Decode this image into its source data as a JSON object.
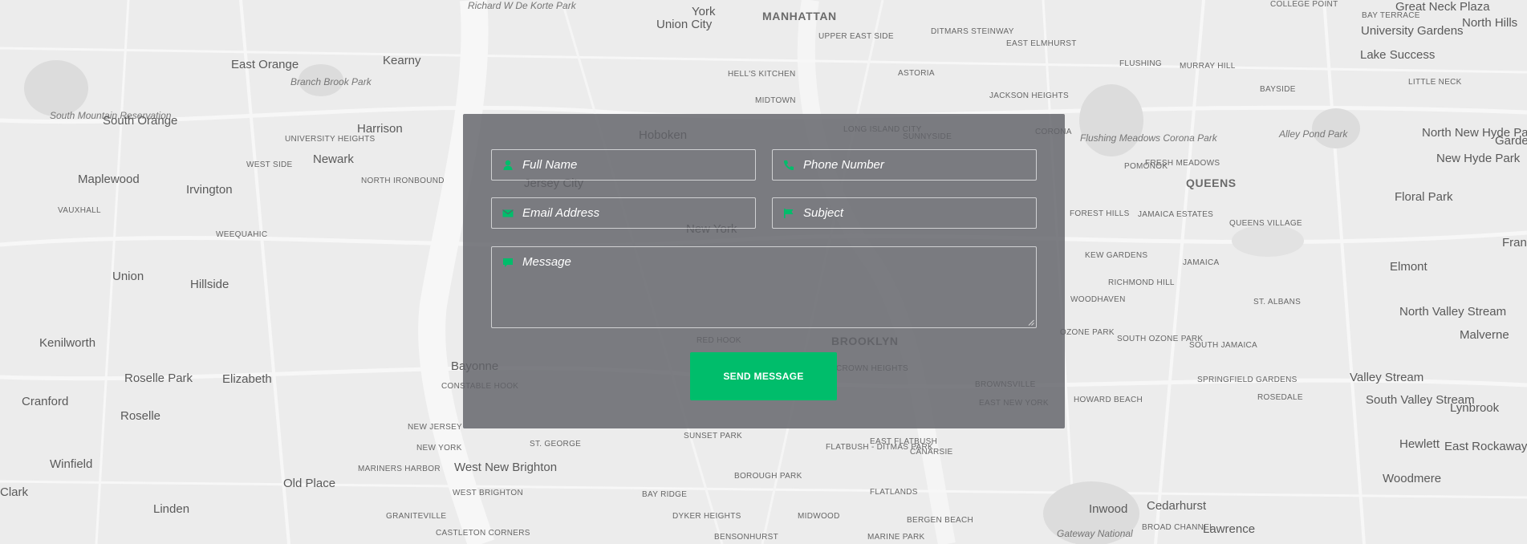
{
  "map": {
    "labels": [
      {
        "text": "Richard W De Korte Park",
        "cls": "italic"
      },
      {
        "text": "Union City",
        "cls": "major"
      },
      {
        "text": "York",
        "cls": "major"
      },
      {
        "text": "MANHATTAN",
        "cls": "bold"
      },
      {
        "text": "COLLEGE POINT",
        "cls": "caps"
      },
      {
        "text": "BAY TERRACE",
        "cls": "caps"
      },
      {
        "text": "Great Neck Plaza",
        "cls": "major"
      },
      {
        "text": "North Hills",
        "cls": "major"
      },
      {
        "text": "East Orange",
        "cls": "major"
      },
      {
        "text": "Kearny",
        "cls": "major"
      },
      {
        "text": "Branch Brook Park",
        "cls": "italic"
      },
      {
        "text": "UPPER EAST SIDE",
        "cls": "caps"
      },
      {
        "text": "DITMARS STEINWAY",
        "cls": "caps"
      },
      {
        "text": "EAST ELMHURST",
        "cls": "caps"
      },
      {
        "text": "University Gardens",
        "cls": "major"
      },
      {
        "text": "Lake Success",
        "cls": "major"
      },
      {
        "text": "HELL'S KITCHEN",
        "cls": "caps"
      },
      {
        "text": "ASTORIA",
        "cls": "caps"
      },
      {
        "text": "FLUSHING",
        "cls": "caps"
      },
      {
        "text": "MURRAY HILL",
        "cls": "caps"
      },
      {
        "text": "LITTLE NECK",
        "cls": "caps"
      },
      {
        "text": "South Mountain Reservation",
        "cls": "italic"
      },
      {
        "text": "South Orange",
        "cls": "major"
      },
      {
        "text": "Harrison",
        "cls": "major"
      },
      {
        "text": "MIDTOWN",
        "cls": "caps"
      },
      {
        "text": "JACKSON HEIGHTS",
        "cls": "caps"
      },
      {
        "text": "BAYSIDE",
        "cls": "caps"
      },
      {
        "text": "Hoboken",
        "cls": "major"
      },
      {
        "text": "LONG ISLAND CITY",
        "cls": "caps"
      },
      {
        "text": "SUNNYSIDE",
        "cls": "caps"
      },
      {
        "text": "CORONA",
        "cls": "caps"
      },
      {
        "text": "Flushing Meadows Corona Park",
        "cls": "italic"
      },
      {
        "text": "Alley Pond Park",
        "cls": "italic"
      },
      {
        "text": "North New Hyde Park",
        "cls": "major"
      },
      {
        "text": "New Hyde Park",
        "cls": "major"
      },
      {
        "text": "Garden City",
        "cls": "major"
      },
      {
        "text": "Newark",
        "cls": "major"
      },
      {
        "text": "UNIVERSITY HEIGHTS",
        "cls": "caps"
      },
      {
        "text": "Maplewood",
        "cls": "major"
      },
      {
        "text": "WEST SIDE",
        "cls": "caps"
      },
      {
        "text": "Irvington",
        "cls": "major"
      },
      {
        "text": "NORTH IRONBOUND",
        "cls": "caps"
      },
      {
        "text": "POMONOK",
        "cls": "caps"
      },
      {
        "text": "FRESH MEADOWS",
        "cls": "caps"
      },
      {
        "text": "QUEENS",
        "cls": "bold"
      },
      {
        "text": "Floral Park",
        "cls": "major"
      },
      {
        "text": "VAUXHALL",
        "cls": "caps"
      },
      {
        "text": "FOREST HILLS",
        "cls": "caps"
      },
      {
        "text": "JAMAICA ESTATES",
        "cls": "caps"
      },
      {
        "text": "QUEENS VILLAGE",
        "cls": "caps"
      },
      {
        "text": "WEEQUAHIC",
        "cls": "caps"
      },
      {
        "text": "Franklin Square",
        "cls": "major"
      },
      {
        "text": "Union",
        "cls": "major"
      },
      {
        "text": "Hillside",
        "cls": "major"
      },
      {
        "text": "KEW GARDENS",
        "cls": "caps"
      },
      {
        "text": "JAMAICA",
        "cls": "caps"
      },
      {
        "text": "Elmont",
        "cls": "major"
      },
      {
        "text": "RICHMOND HILL",
        "cls": "caps"
      },
      {
        "text": "WOODHAVEN",
        "cls": "caps"
      },
      {
        "text": "ST. ALBANS",
        "cls": "caps"
      },
      {
        "text": "North Valley Stream",
        "cls": "major"
      },
      {
        "text": "Kenilworth",
        "cls": "major"
      },
      {
        "text": "OZONE PARK",
        "cls": "caps"
      },
      {
        "text": "SOUTH OZONE PARK",
        "cls": "caps"
      },
      {
        "text": "SOUTH JAMAICA",
        "cls": "caps"
      },
      {
        "text": "Malverne",
        "cls": "major"
      },
      {
        "text": "Roselle Park",
        "cls": "major"
      },
      {
        "text": "Elizabeth",
        "cls": "major"
      },
      {
        "text": "Bayonne",
        "cls": "major"
      },
      {
        "text": "CONSTABLE HOOK",
        "cls": "caps"
      },
      {
        "text": "SPRINGFIELD GARDENS",
        "cls": "caps"
      },
      {
        "text": "Valley Stream",
        "cls": "major"
      },
      {
        "text": "Cranford",
        "cls": "major"
      },
      {
        "text": "HOWARD BEACH",
        "cls": "caps"
      },
      {
        "text": "ROSEDALE",
        "cls": "caps"
      },
      {
        "text": "South Valley Stream",
        "cls": "major"
      },
      {
        "text": "Lynbrook",
        "cls": "major"
      },
      {
        "text": "Roselle",
        "cls": "major"
      },
      {
        "text": "NEW JERSEY",
        "cls": "caps"
      },
      {
        "text": "NEW YORK",
        "cls": "caps"
      },
      {
        "text": "SUNSET PARK",
        "cls": "caps"
      },
      {
        "text": "EAST FLATBUSH",
        "cls": "caps"
      },
      {
        "text": "ST. GEORGE",
        "cls": "caps"
      },
      {
        "text": "FLATBUSH - DITMAS PARK",
        "cls": "caps"
      },
      {
        "text": "CANARSIE",
        "cls": "caps"
      },
      {
        "text": "Hewlett",
        "cls": "major"
      },
      {
        "text": "East Rockaway",
        "cls": "major"
      },
      {
        "text": "Winfield",
        "cls": "major"
      },
      {
        "text": "West New Brighton",
        "cls": "major"
      },
      {
        "text": "MARINERS HARBOR",
        "cls": "caps"
      },
      {
        "text": "BOROUGH PARK",
        "cls": "caps"
      },
      {
        "text": "Woodmere",
        "cls": "major"
      },
      {
        "text": "Clark",
        "cls": "major"
      },
      {
        "text": "Old Place",
        "cls": "major"
      },
      {
        "text": "WEST BRIGHTON",
        "cls": "caps"
      },
      {
        "text": "BAY RIDGE",
        "cls": "caps"
      },
      {
        "text": "FLATLANDS",
        "cls": "caps"
      },
      {
        "text": "Inwood",
        "cls": "major"
      },
      {
        "text": "Cedarhurst",
        "cls": "major"
      },
      {
        "text": "Linden",
        "cls": "major"
      },
      {
        "text": "GRANITEVILLE",
        "cls": "caps"
      },
      {
        "text": "DYKER HEIGHTS",
        "cls": "caps"
      },
      {
        "text": "MIDWOOD",
        "cls": "caps"
      },
      {
        "text": "BERGEN BEACH",
        "cls": "caps"
      },
      {
        "text": "BROAD CHANNEL",
        "cls": "caps"
      },
      {
        "text": "Lawrence",
        "cls": "major"
      },
      {
        "text": "CASTLETON CORNERS",
        "cls": "caps"
      },
      {
        "text": "BENSONHURST",
        "cls": "caps"
      },
      {
        "text": "MARINE PARK",
        "cls": "caps"
      },
      {
        "text": "Gateway National",
        "cls": "italic"
      },
      {
        "text": "BROOKLYN",
        "cls": "bold"
      },
      {
        "text": "RED HOOK",
        "cls": "caps"
      },
      {
        "text": "CROWN HEIGHTS",
        "cls": "caps"
      },
      {
        "text": "BROWNSVILLE",
        "cls": "caps"
      },
      {
        "text": "EAST NEW YORK",
        "cls": "caps"
      },
      {
        "text": "New York",
        "cls": "major"
      },
      {
        "text": "Jersey City",
        "cls": "major"
      }
    ]
  },
  "form": {
    "full_name": {
      "placeholder": "Full Name",
      "icon": "user-icon"
    },
    "phone_number": {
      "placeholder": "Phone Number",
      "icon": "phone-icon"
    },
    "email_address": {
      "placeholder": "Email Address",
      "icon": "envelope-icon"
    },
    "subject": {
      "placeholder": "Subject",
      "icon": "flag-icon"
    },
    "message": {
      "placeholder": "Message",
      "icon": "comment-icon"
    },
    "send_label": "SEND MESSAGE",
    "accent_color": "#00bd6b",
    "panel_color": "#606268"
  }
}
